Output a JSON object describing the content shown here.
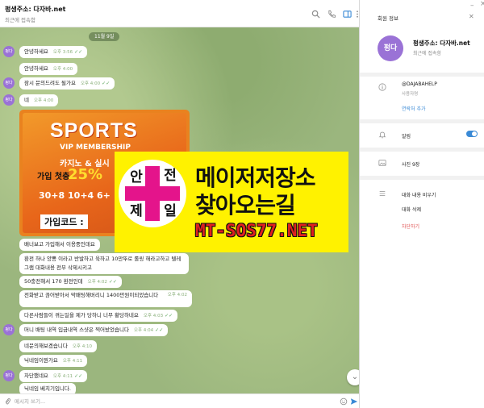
{
  "chat": {
    "title": "펑생주소: 다자바.net",
    "status": "최근에 접속함",
    "date": "11월 9일",
    "scroll_down": "⌄"
  },
  "messages": [
    {
      "avatar": "펑다",
      "text": "안녕하세요",
      "time": "오후 3:56",
      "checks": "✓✓"
    },
    {
      "avatar": "",
      "text": "안녕하세요",
      "time": "오후 4:00",
      "checks": ""
    },
    {
      "avatar": "펑다",
      "text": "잠시 문의드려도 될가요",
      "time": "오후 4:00",
      "checks": "✓✓"
    },
    {
      "avatar": "펑다",
      "text": "네",
      "time": "오후 4:00",
      "checks": ""
    },
    {
      "avatar": "",
      "text": "배너보고 가입해서 이용중인데요",
      "time": "",
      "checks": ""
    },
    {
      "avatar": "",
      "text": "환전 하나 양뽕 이라고 반발하고 육하고 10만뚜로 롤링 해라고하고 텔레그램 대화내용 전부 삭제시키고",
      "time": "",
      "checks": ""
    },
    {
      "avatar": "",
      "text": "50충전해서 170 환전인데",
      "time": "오후 4:02",
      "checks": "✓✓"
    },
    {
      "avatar": "",
      "text": "전화받고 끊어받아서 막배팅해버리니 1400만원이되었습니다",
      "time": "오후 4:02",
      "checks": "✓✓"
    },
    {
      "avatar": "",
      "text": "다른사람들이 겪는일을 제가 당하니 너무 황당하네요",
      "time": "오후 4:03",
      "checks": "✓✓"
    },
    {
      "avatar": "펑다",
      "text": "머니 배팅 내역 입금내역 스샷은 찍어놨었습니다",
      "time": "오후 4:04",
      "checks": "✓✓"
    },
    {
      "avatar": "",
      "text": "네문의해보겠습니다",
      "time": "오후 4:10",
      "checks": ""
    },
    {
      "avatar": "",
      "text": "닉네임이뭔가요",
      "time": "오후 4:11",
      "checks": ""
    },
    {
      "avatar": "펑다",
      "text": "차단했네요",
      "time": "오후 4:11",
      "checks": "✓✓"
    },
    {
      "avatar": "",
      "text": "닉네임 베치기입니다.",
      "time": "",
      "checks": ""
    }
  ],
  "photo": {
    "title": "SPORTS",
    "vip": "VIP MEMBERSHIP",
    "line1": "카지노 & 실시",
    "line2": "가입 첫충",
    "pct": "25%",
    "row": "30+8 10+4 6+",
    "code": "가입코드 :"
  },
  "banner": {
    "logo": [
      "안",
      "전",
      "제",
      "일"
    ],
    "line1": "메이저저장소",
    "line2": "찾아오는길",
    "line3": "MT-SOS77.NET"
  },
  "composer": {
    "placeholder": "메시지 쓰기..."
  },
  "info": {
    "title": "회원 정보",
    "avatar": "펑다",
    "name": "펑생주소: 다자바.net",
    "status": "최근에 접속함",
    "username": "@DAJABAHELP",
    "username_label": "사용자명",
    "add_contact": "연락처 추가",
    "notifications": "알림",
    "photos": "사진 9장",
    "clear_history": "대화 내용 비우기",
    "delete_chat": "대화 삭제",
    "block": "차단하기"
  }
}
